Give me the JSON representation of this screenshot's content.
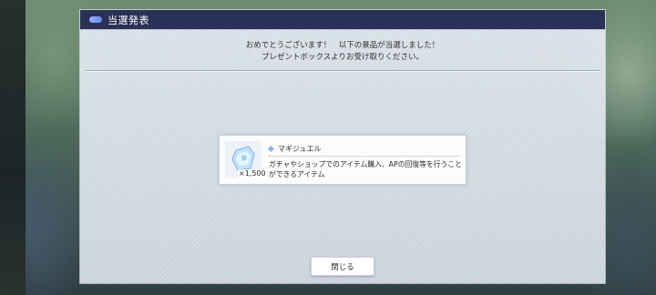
{
  "dialog": {
    "title": "当選発表",
    "message_line1": "おめでとうございます！　以下の景品が当選しました！",
    "message_line2": "プレゼントボックスよりお受け取りください。"
  },
  "prize": {
    "name": "マギジュエル",
    "quantity": "×1,500",
    "description_line1": "ガチャやショップでのアイテム購入、APの回復等を行うこと",
    "description_line2": "ができるアイテム",
    "icon": "magi-jewel-icon"
  },
  "buttons": {
    "close_label": "閉じる"
  }
}
